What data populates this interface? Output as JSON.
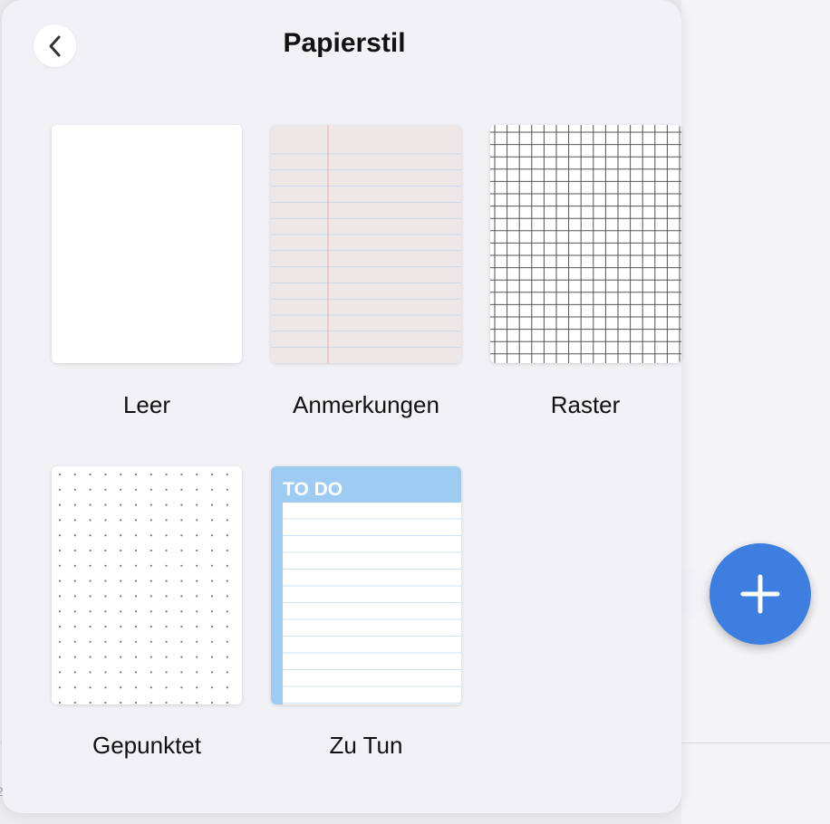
{
  "popover": {
    "title": "Papierstil",
    "back_icon": "chevron-left-icon"
  },
  "paper_styles": [
    {
      "label": "Leer"
    },
    {
      "label": "Anmerkungen"
    },
    {
      "label": "Raster"
    },
    {
      "label": "Gepunktet"
    },
    {
      "label": "Zu Tun",
      "header_text": "TO DO"
    }
  ],
  "fab": {
    "icon": "plus-icon"
  },
  "colors": {
    "accent": "#3d7ee0",
    "todo_header": "#9ecbf2",
    "notes_paper": "#ede8e7",
    "notes_margin": "#e6b0a8",
    "notes_lines": "#c9d6e8",
    "grid_lines": "#555555"
  }
}
